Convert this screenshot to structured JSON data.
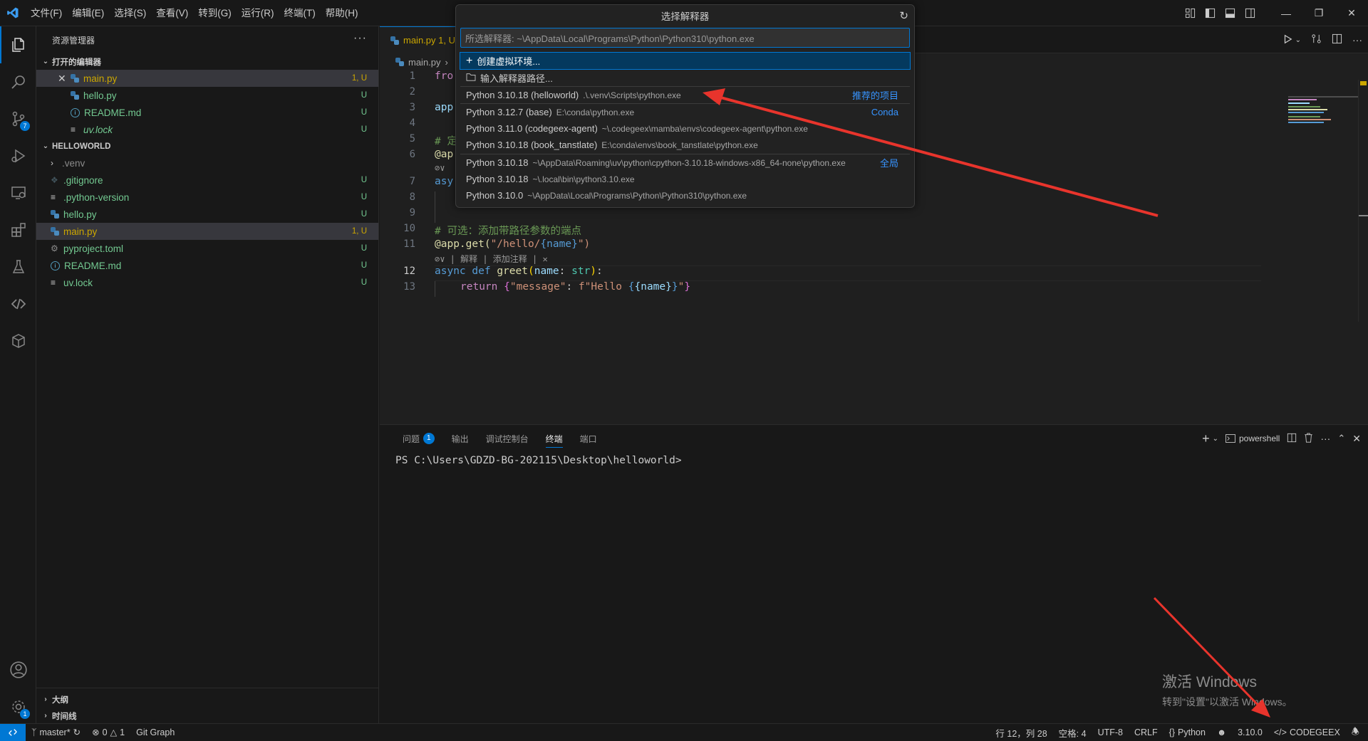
{
  "titlebar": {
    "menus": [
      "文件(F)",
      "编辑(E)",
      "选择(S)",
      "查看(V)",
      "转到(G)",
      "运行(R)",
      "终端(T)",
      "帮助(H)"
    ]
  },
  "activity_bar": {
    "source_control_badge": "7",
    "settings_badge": "1"
  },
  "sidebar": {
    "title": "资源管理器",
    "open_editors_label": "打开的编辑器",
    "open_editors": [
      {
        "name": "main.py",
        "status": "1, U"
      },
      {
        "name": "hello.py",
        "status": "U"
      },
      {
        "name": "README.md",
        "status": "U"
      },
      {
        "name": "uv.lock",
        "status": "U"
      }
    ],
    "folder_label": "HELLOWORLD",
    "files": [
      {
        "name": ".venv",
        "status": ""
      },
      {
        "name": ".gitignore",
        "status": "U"
      },
      {
        "name": ".python-version",
        "status": "U"
      },
      {
        "name": "hello.py",
        "status": "U"
      },
      {
        "name": "main.py",
        "status": "1, U"
      },
      {
        "name": "pyproject.toml",
        "status": "U"
      },
      {
        "name": "README.md",
        "status": "U"
      },
      {
        "name": "uv.lock",
        "status": "U"
      }
    ],
    "outline_label": "大纲",
    "timeline_label": "时间线"
  },
  "editor": {
    "tab_label": "main.py 1, U",
    "breadcrumb": "main.py",
    "line_numbers": [
      "1",
      "2",
      "3",
      "4",
      "5",
      "6",
      "7",
      "8",
      "9",
      "10",
      "11",
      "12",
      "13"
    ],
    "code": {
      "l1": "fro",
      "l3": "app",
      "l5": "# 定",
      "l6": "@ap",
      "l7": "asy",
      "l10": "# 可选：添加带路径参数的端点",
      "l11_dec": "@app.get(",
      "l11_str": "\"/hello/",
      "l11_var": "{name}",
      "l11_end": "\")",
      "l12_async": "async",
      "l12_def": "def",
      "l12_fn": "greet",
      "l12_param": "name",
      "l12_type": "str",
      "l13_return": "return",
      "l13_key": "\"message\"",
      "l13_f": "f\"Hello ",
      "l13_var": "{name}",
      "l13_end": "\""
    },
    "codelens": "⊘∨ | 解释 | 添加注释 | ✕",
    "codelens_short": "⊘∨"
  },
  "quick_pick": {
    "title": "选择解释器",
    "input_placeholder": "所选解释器: ~\\AppData\\Local\\Programs\\Python\\Python310\\python.exe",
    "create_env": "创建虚拟环境...",
    "enter_path": "输入解释器路径...",
    "items": [
      {
        "name": "Python 3.10.18 (helloworld)",
        "path": ".\\.venv\\Scripts\\python.exe",
        "tag": "推荐的项目"
      },
      {
        "name": "Python 3.12.7 (base)",
        "path": "E:\\conda\\python.exe",
        "tag": "Conda"
      },
      {
        "name": "Python 3.11.0 (codegeex-agent)",
        "path": "~\\.codegeex\\mamba\\envs\\codegeex-agent\\python.exe",
        "tag": ""
      },
      {
        "name": "Python 3.10.18 (book_tanstlate)",
        "path": "E:\\conda\\envs\\book_tanstlate\\python.exe",
        "tag": ""
      },
      {
        "name": "Python 3.10.18",
        "path": "~\\AppData\\Roaming\\uv\\python\\cpython-3.10.18-windows-x86_64-none\\python.exe",
        "tag": "全局"
      },
      {
        "name": "Python 3.10.18",
        "path": "~\\.local\\bin\\python3.10.exe",
        "tag": ""
      },
      {
        "name": "Python 3.10.0",
        "path": "~\\AppData\\Local\\Programs\\Python\\Python310\\python.exe",
        "tag": ""
      }
    ]
  },
  "panel": {
    "tabs": [
      "问题",
      "输出",
      "调试控制台",
      "终端",
      "端口"
    ],
    "problems_count": "1",
    "terminal_name": "powershell",
    "prompt": "PS C:\\Users\\GDZD-BG-202115\\Desktop\\helloworld>"
  },
  "watermark": {
    "line1": "激活 Windows",
    "line2": "转到\"设置\"以激活 Windows。"
  },
  "statusbar": {
    "branch": "master*",
    "errors": "0",
    "warnings": "1",
    "git_graph": "Git Graph",
    "position": "行 12，列 28",
    "spaces": "空格: 4",
    "encoding": "UTF-8",
    "eol": "CRLF",
    "language": "Python",
    "python_version": "3.10.0",
    "codegeex": "CODEGEEX"
  },
  "colors": {
    "accent": "#0078d4",
    "untracked": "#73c991",
    "modified": "#cca700",
    "arrow": "#e8342c"
  }
}
